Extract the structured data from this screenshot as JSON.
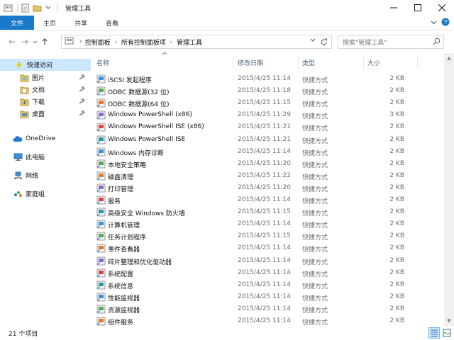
{
  "window": {
    "title": "管理工具",
    "controls": [
      "minimize",
      "maximize",
      "close"
    ]
  },
  "ribbon": {
    "tabs": [
      "文件",
      "主页",
      "共享",
      "查看"
    ]
  },
  "address": {
    "crumbs": [
      "控制面板",
      "所有控制面板项",
      "管理工具"
    ],
    "search_placeholder": "搜索\"管理工具\""
  },
  "nav": {
    "items": [
      {
        "label": "快速访问",
        "icon": "star-icon",
        "selected": true
      },
      {
        "label": "图片",
        "icon": "folder-icon",
        "pinned": true
      },
      {
        "label": "文档",
        "icon": "folder-icon",
        "pinned": true
      },
      {
        "label": "下载",
        "icon": "download-folder-icon",
        "pinned": true
      },
      {
        "label": "桌面",
        "icon": "folder-icon",
        "pinned": true
      },
      {
        "label": "OneDrive",
        "icon": "cloud-icon"
      },
      {
        "label": "此电脑",
        "icon": "computer-icon"
      },
      {
        "label": "网络",
        "icon": "network-icon"
      },
      {
        "label": "家庭组",
        "icon": "homegroup-icon"
      }
    ]
  },
  "columns": {
    "name": "名称",
    "date": "修改日期",
    "type": "类型",
    "size": "大小"
  },
  "files": [
    {
      "name": "iSCSI 发起程序",
      "date": "2015/4/25 11:14",
      "type": "快捷方式",
      "size": "2 KB"
    },
    {
      "name": "ODBC 数据源(32 位)",
      "date": "2015/4/25 11:18",
      "type": "快捷方式",
      "size": "2 KB"
    },
    {
      "name": "ODBC 数据源(64 位)",
      "date": "2015/4/25 11:15",
      "type": "快捷方式",
      "size": "2 KB"
    },
    {
      "name": "Windows PowerShell (x86)",
      "date": "2015/4/25 11:29",
      "type": "快捷方式",
      "size": "3 KB"
    },
    {
      "name": "Windows PowerShell ISE (x86)",
      "date": "2015/4/25 11:21",
      "type": "快捷方式",
      "size": "2 KB"
    },
    {
      "name": "Windows PowerShell ISE",
      "date": "2015/4/25 11:21",
      "type": "快捷方式",
      "size": "2 KB"
    },
    {
      "name": "Windows 内存诊断",
      "date": "2015/4/25 11:14",
      "type": "快捷方式",
      "size": "2 KB"
    },
    {
      "name": "本地安全策略",
      "date": "2015/4/25 11:20",
      "type": "快捷方式",
      "size": "2 KB"
    },
    {
      "name": "磁盘清理",
      "date": "2015/4/25 11:22",
      "type": "快捷方式",
      "size": "2 KB"
    },
    {
      "name": "打印管理",
      "date": "2015/4/25 11:20",
      "type": "快捷方式",
      "size": "2 KB"
    },
    {
      "name": "服务",
      "date": "2015/4/25 11:14",
      "type": "快捷方式",
      "size": "2 KB"
    },
    {
      "name": "高级安全 Windows 防火墙",
      "date": "2015/4/25 11:15",
      "type": "快捷方式",
      "size": "2 KB"
    },
    {
      "name": "计算机管理",
      "date": "2015/4/25 11:14",
      "type": "快捷方式",
      "size": "2 KB"
    },
    {
      "name": "任务计划程序",
      "date": "2015/4/25 11:15",
      "type": "快捷方式",
      "size": "2 KB"
    },
    {
      "name": "事件查看器",
      "date": "2015/4/25 11:14",
      "type": "快捷方式",
      "size": "2 KB"
    },
    {
      "name": "碎片整理和优化驱动器",
      "date": "2015/4/25 11:14",
      "type": "快捷方式",
      "size": "2 KB"
    },
    {
      "name": "系统配置",
      "date": "2015/4/25 11:14",
      "type": "快捷方式",
      "size": "2 KB"
    },
    {
      "name": "系统信息",
      "date": "2015/4/25 11:14",
      "type": "快捷方式",
      "size": "2 KB"
    },
    {
      "name": "性能监视器",
      "date": "2015/4/25 11:14",
      "type": "快捷方式",
      "size": "2 KB"
    },
    {
      "name": "资源监视器",
      "date": "2015/4/25 11:14",
      "type": "快捷方式",
      "size": "2 KB"
    },
    {
      "name": "组件服务",
      "date": "2015/4/25 11:14",
      "type": "快捷方式",
      "size": "2 KB"
    }
  ],
  "status": {
    "item_count": "21 个项目"
  },
  "colors": {
    "file_tab": "#1979ca",
    "nav_selected": "#cce8ff",
    "header_text": "#4c607a",
    "meta_text": "#6d6d6d"
  }
}
